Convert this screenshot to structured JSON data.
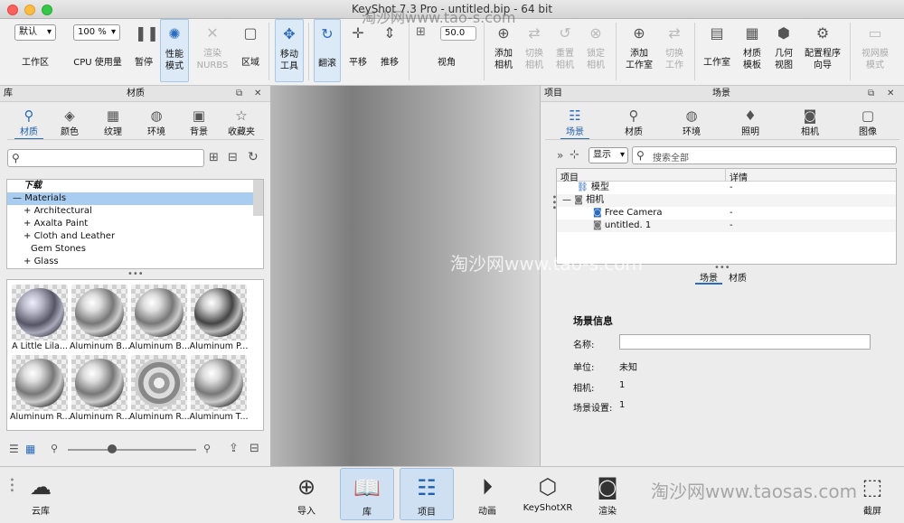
{
  "window": {
    "title": "KeyShot 7.3 Pro - untitled.bip - 64 bit"
  },
  "toolbar": {
    "workspace_value": "默认",
    "workspace_label": "工作区",
    "cpu_value": "100 %",
    "cpu_label": "CPU 使用量",
    "pause": "暂停",
    "perf_mode": "性能\n模式",
    "render_nurbs": "渲染\nNURBS",
    "region": "区域",
    "move_tool": "移动\n工具",
    "tumble": "翻滚",
    "pan": "平移",
    "dolly": "推移",
    "fov_value": "50.0",
    "view_angle": "视角",
    "add_camera": "添加\n相机",
    "switch_camera": "切换\n相机",
    "reset_camera": "重置\n相机",
    "lock_camera": "锁定\n相机",
    "add_studio": "添加\n工作室",
    "switch_studio": "切换\n工作",
    "studio": "工作室",
    "material_template": "材质\n模板",
    "geometry_view": "几何\n视图",
    "config_wizard": "配置程序\n向导",
    "viewer_mode": "视网膜\n模式"
  },
  "library": {
    "panel_title": "库",
    "panel_subtitle": "材质",
    "tabs": [
      "材质",
      "颜色",
      "纹理",
      "环境",
      "背景",
      "收藏夹"
    ],
    "search_placeholder": "",
    "tree": [
      "下载",
      "Materials",
      "Architectural",
      "Axalta Paint",
      "Cloth and Leather",
      "Gem Stones",
      "Glass"
    ],
    "thumbnails": [
      "A Little Lila...",
      "Aluminum B...",
      "Aluminum B...",
      "Aluminum P...",
      "Aluminum R...",
      "Aluminum R...",
      "Aluminum R...",
      "Aluminum T..."
    ]
  },
  "project": {
    "panel_title": "项目",
    "panel_subtitle": "场景",
    "tabs": [
      "场景",
      "材质",
      "环境",
      "照明",
      "相机",
      "图像"
    ],
    "show_label": "显示",
    "search_placeholder": "搜索全部",
    "col_item": "项目",
    "col_detail": "详情",
    "rows": [
      {
        "name": "模型",
        "detail": "-"
      },
      {
        "name": "相机",
        "detail": ""
      },
      {
        "name": "Free Camera",
        "detail": "-"
      },
      {
        "name": "untitled. 1",
        "detail": "-"
      }
    ],
    "sub_tabs": [
      "场景",
      "材质"
    ],
    "info_title": "场景信息",
    "name_label": "名称:",
    "name_value": "",
    "unit_label": "单位:",
    "unit_value": "未知",
    "camera_label": "相机:",
    "camera_value": "1",
    "settings_label": "场景设置:",
    "settings_value": "1"
  },
  "bottom_bar": {
    "cloud": "云库",
    "import": "导入",
    "library": "库",
    "project": "项目",
    "animation": "动画",
    "keyshotxr": "KeyShotXR",
    "render": "渲染",
    "screenshot": "截屏"
  },
  "watermarks": [
    "淘沙网www.tao-s.com",
    "淘沙网www.tao-s.com",
    "淘沙网www.taosas.com"
  ]
}
